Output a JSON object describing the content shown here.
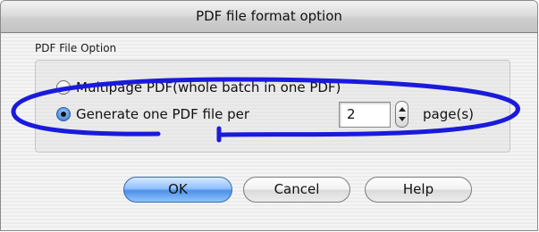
{
  "window": {
    "title": "PDF file format option"
  },
  "group": {
    "label": "PDF File Option"
  },
  "options": {
    "multipage_label": "Multipage PDF(whole batch in one PDF)",
    "multipage_selected": false,
    "per_page_label": "Generate one PDF file per",
    "per_page_selected": true
  },
  "pages": {
    "value": "2",
    "suffix": "page(s)"
  },
  "buttons": {
    "ok": "OK",
    "cancel": "Cancel",
    "help": "Help"
  },
  "colors": {
    "annotation_stroke": "#1a1adc",
    "default_button": "#5b9ae8"
  },
  "icons": {
    "stepper": "up-down-arrows-icon",
    "radio": "radio-button-icon"
  }
}
